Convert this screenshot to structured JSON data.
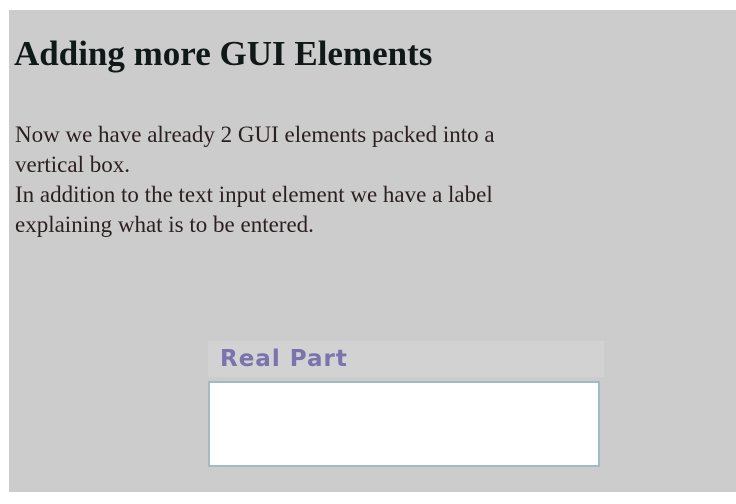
{
  "slide": {
    "title": "Adding more GUI Elements",
    "paragraph_lines": [
      "Now we have already 2 GUI elements packed into a",
      "vertical box.",
      "In addition to the text input element we have a label",
      "explaining what is to be entered."
    ]
  },
  "widget": {
    "label": "Real Part",
    "input": {
      "value": "",
      "placeholder": ""
    }
  },
  "colors": {
    "page_background": "#cccccc",
    "title_text": "#101818",
    "body_text": "#2b2020",
    "label_text": "#7a73ad",
    "input_border": "#9fbcc0"
  }
}
